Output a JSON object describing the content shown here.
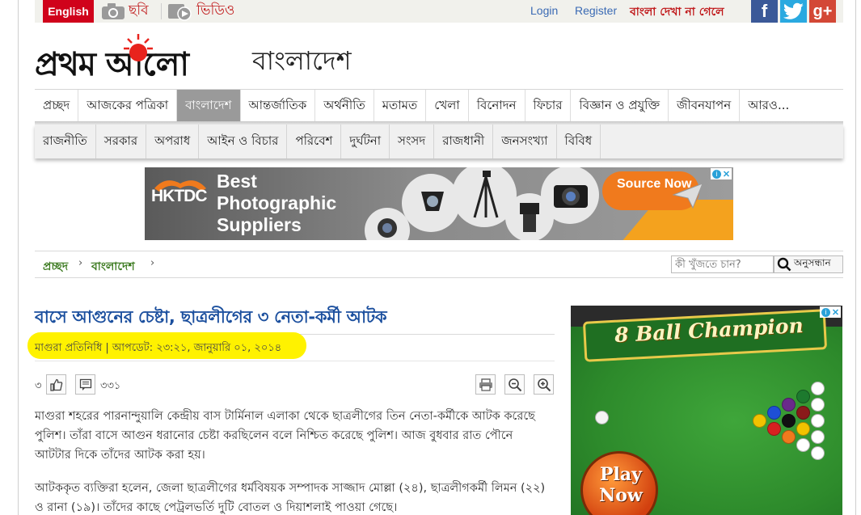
{
  "topbar": {
    "english_label": "English",
    "photo_label": "ছবি",
    "video_label": "ভিডিও",
    "login_label": "Login",
    "register_label": "Register",
    "font_help_label": "বাংলা দেখা না গেলে",
    "social": [
      {
        "name": "facebook",
        "glyph": "f",
        "color": "#3b5998"
      },
      {
        "name": "twitter",
        "glyph": "t",
        "color": "#2aa9e0"
      },
      {
        "name": "google-plus",
        "glyph": "g+",
        "color": "#d34836"
      }
    ]
  },
  "brand": {
    "logo_text": "প্রথম আলো",
    "sun_color": "#e8231d",
    "section_title": "বাংলাদেশ"
  },
  "main_nav": {
    "items": [
      "প্রচ্ছদ",
      "আজকের পত্রিকা",
      "বাংলাদেশ",
      "আন্তর্জাতিক",
      "অর্থনীতি",
      "মতামত",
      "খেলা",
      "বিনোদন",
      "ফিচার",
      "বিজ্ঞান ও প্রযুক্তি",
      "জীবনযাপন",
      "আরও..."
    ],
    "active_index": 2
  },
  "sub_nav": {
    "items": [
      "রাজনীতি",
      "সরকার",
      "অপরাধ",
      "আইন ও বিচার",
      "পরিবেশ",
      "দুর্ঘটনা",
      "সংসদ",
      "রাজধানী",
      "জনসংখ্যা",
      "বিবিধ"
    ]
  },
  "banner_ad": {
    "brand": "HKTDC",
    "headline": "Best Photographic Suppliers",
    "cta": "Source Now"
  },
  "breadcrumb": {
    "items": [
      "প্রচ্ছদ",
      "বাংলাদেশ"
    ],
    "separator": "›"
  },
  "search": {
    "placeholder": "কী খুঁজতে চান?",
    "button_label": "অনুসন্ধান"
  },
  "article": {
    "title": "বাসে আগুনের চেষ্টা, ছাত্রলীগের ৩ নেতা-কর্মী আটক",
    "byline": "মাগুরা প্রতিনিধি | আপডেট: ২৩:২১, জানুয়ারি ০১, ২০১৪",
    "highlight_color": "#fff200",
    "like_count": "৩",
    "comment_count": "৩৩১",
    "paragraphs": [
      "মাগুরা শহরের পারনান্দুয়ালি কেন্দ্রীয় বাস টার্মিনাল এলাকা থেকে ছাত্রলীগের তিন নেতা-কর্মীকে আটক করেছে পুলিশ। তাঁরা বাসে আগুন ধরানোর চেষ্টা করছিলেন বলে নিশ্চিত করেছে পুলিশ। আজ বুধবার রাত পৌনে আটটার দিকে তাঁদের আটক করা হয়।",
      "আটককৃত ব্যক্তিরা হলেন, জেলা ছাত্রলীগের ধর্মবিষয়ক সম্পাদক সাজ্জাদ মোল্লা (২৪), ছাত্রলীগকর্মী লিমন (২২) ও রানা (১৯)। তাঁদের কাছে পেট্রলভর্তি দুটি বোতল ও দিয়াশলাই পাওয়া গেছে।"
    ]
  },
  "side_ad": {
    "title": "8 Ball Champion",
    "cta": "Play Now"
  }
}
